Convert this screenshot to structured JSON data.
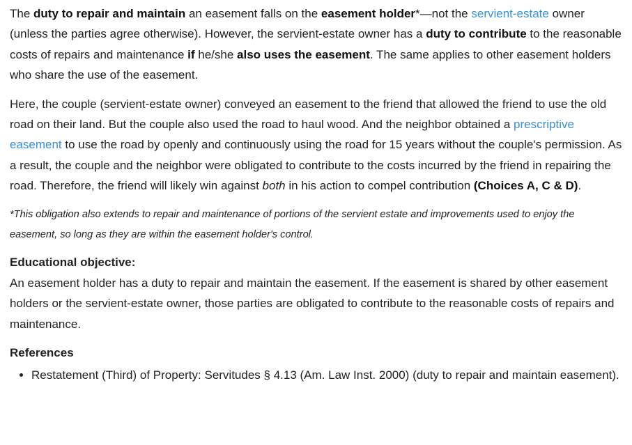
{
  "p1": {
    "t1": "The ",
    "b1": "duty to repair and maintain",
    "t2": " an easement falls on the ",
    "b2": "easement holder",
    "t3": "*—not the ",
    "link1": "servient-estate",
    "t4": " owner (unless the parties agree otherwise).  However, the servient-estate owner has a ",
    "b3": "duty to contribute",
    "t5": " to the reasonable costs of repairs and maintenance ",
    "b4": "if",
    "t6": " he/she ",
    "b5": "also uses the easement",
    "t7": ".  The same applies to other easement holders who share the use of the easement."
  },
  "p2": {
    "t1": "Here, the couple (servient-estate owner) conveyed an easement to the friend that allowed the friend to use the old road on their land.  But the couple also used the road to haul wood.  And the neighbor obtained a ",
    "link1": "prescriptive easement",
    "t2": " to use the road by openly and continuously using the road for 15 years without the couple's permission.  As a result, the couple and the neighbor were obligated to contribute to the costs incurred by the friend in repairing the road.  Therefore, the friend will likely win against ",
    "i1": "both",
    "t3": " in his action to compel contribution ",
    "b1": "(Choices A, C & D)",
    "t4": "."
  },
  "note": "*This obligation also extends to repair and maintenance of portions of the servient estate and improvements used to enjoy the easement, so long as they are within the easement holder's control.",
  "objective": {
    "heading": "Educational objective:",
    "text": "An easement holder has a duty to repair and maintain the easement.  If the easement is shared by other easement holders or the servient-estate owner, those parties are obligated to contribute to the reasonable costs of repairs and maintenance."
  },
  "references": {
    "heading": "References",
    "items": [
      "Restatement (Third) of Property: Servitudes § 4.13 (Am. Law Inst. 2000) (duty to repair and maintain easement)."
    ]
  },
  "colors": {
    "text": "#222222",
    "link": "#3a8fd6"
  }
}
